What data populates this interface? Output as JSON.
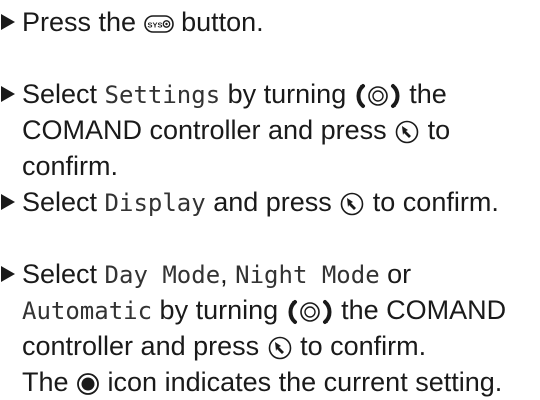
{
  "steps": [
    {
      "lines": [
        [
          {
            "t": "Press the "
          },
          {
            "icon": "sys-button-icon",
            "label": "SYS"
          },
          {
            "t": " button."
          }
        ]
      ]
    },
    {
      "lines": [
        [
          {
            "t": "Select "
          },
          {
            "m": "Settings"
          },
          {
            "t": " by turning "
          },
          {
            "icon": "turn-controller-icon"
          },
          {
            "t": " the"
          }
        ],
        [
          {
            "t": "COMAND controller and press "
          },
          {
            "icon": "press-controller-icon"
          },
          {
            "t": " to"
          }
        ],
        [
          {
            "t": "confirm."
          }
        ]
      ]
    },
    {
      "lines": [
        [
          {
            "t": "Select "
          },
          {
            "m": "Display"
          },
          {
            "t": " and press "
          },
          {
            "icon": "press-controller-icon"
          },
          {
            "t": " to confirm."
          }
        ]
      ]
    },
    {
      "lines": [
        [
          {
            "t": "Select "
          },
          {
            "m": "Day Mode"
          },
          {
            "t": ", "
          },
          {
            "m": "Night Mode"
          },
          {
            "t": " or"
          }
        ],
        [
          {
            "m": "Automatic"
          },
          {
            "t": " by turning "
          },
          {
            "icon": "turn-controller-icon"
          },
          {
            "t": " the COMAND"
          }
        ],
        [
          {
            "t": "controller and press "
          },
          {
            "icon": "press-controller-icon"
          },
          {
            "t": " to confirm."
          }
        ],
        [
          {
            "t": "The "
          },
          {
            "icon": "radio-selected-icon"
          },
          {
            "t": " icon indicates the current setting."
          }
        ]
      ]
    }
  ]
}
